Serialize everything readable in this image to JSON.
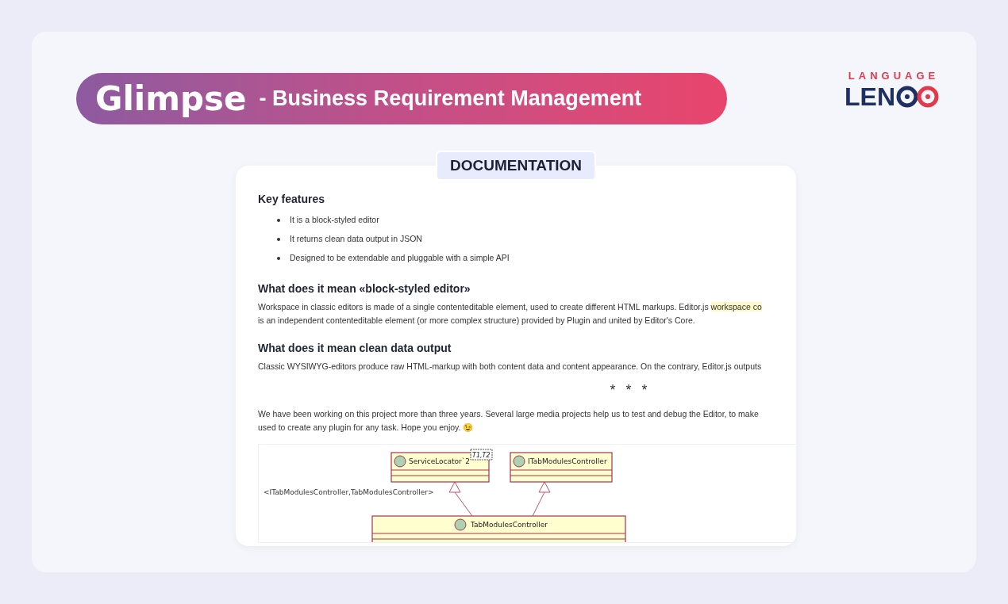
{
  "header": {
    "title": "Glimpse",
    "subtitle": "- Business Requirement Management"
  },
  "logo": {
    "top": "LANGUAGE",
    "word": "LEN"
  },
  "section_tag": "DOCUMENTATION",
  "document": {
    "blocks": [
      {
        "kind": "heading",
        "text": "Key features"
      },
      {
        "kind": "list",
        "items": [
          "It is a block-styled editor",
          "It returns clean data output in JSON",
          "Designed to be extendable and pluggable with a simple API"
        ]
      },
      {
        "kind": "heading",
        "text": "What does it mean «block-styled editor»"
      },
      {
        "kind": "paragraph",
        "lines": [
          {
            "text": "Workspace in classic editors is made of a single contenteditable element, used to create different HTML markups. Editor.js ",
            "highlight": "workspace co"
          },
          {
            "text": "is an independent contenteditable element (or more complex structure) provided by Plugin and united by Editor's Core."
          }
        ]
      },
      {
        "kind": "heading",
        "text": "What does it mean clean data output"
      },
      {
        "kind": "paragraph",
        "lines": [
          {
            "text": "Classic WYSIWYG-editors produce raw HTML-markup with both content data and content appearance. On the contrary, Editor.js outputs"
          }
        ]
      },
      {
        "kind": "delimiter",
        "text": "* * *"
      },
      {
        "kind": "paragraph",
        "lines": [
          {
            "text": "We have been working on this project more than three years. Several large media projects help us to test and debug the Editor, to make"
          },
          {
            "text": "used to create any plugin for any task. Hope you enjoy. 😉"
          }
        ]
      },
      {
        "kind": "diagram",
        "note": "<ITabModulesController,TabModulesController>",
        "classes": [
          {
            "name": "ServiceLocator`2",
            "template": "T1,T2"
          },
          {
            "name": "ITabModulesController"
          },
          {
            "name": "TabModulesController"
          }
        ]
      }
    ]
  }
}
